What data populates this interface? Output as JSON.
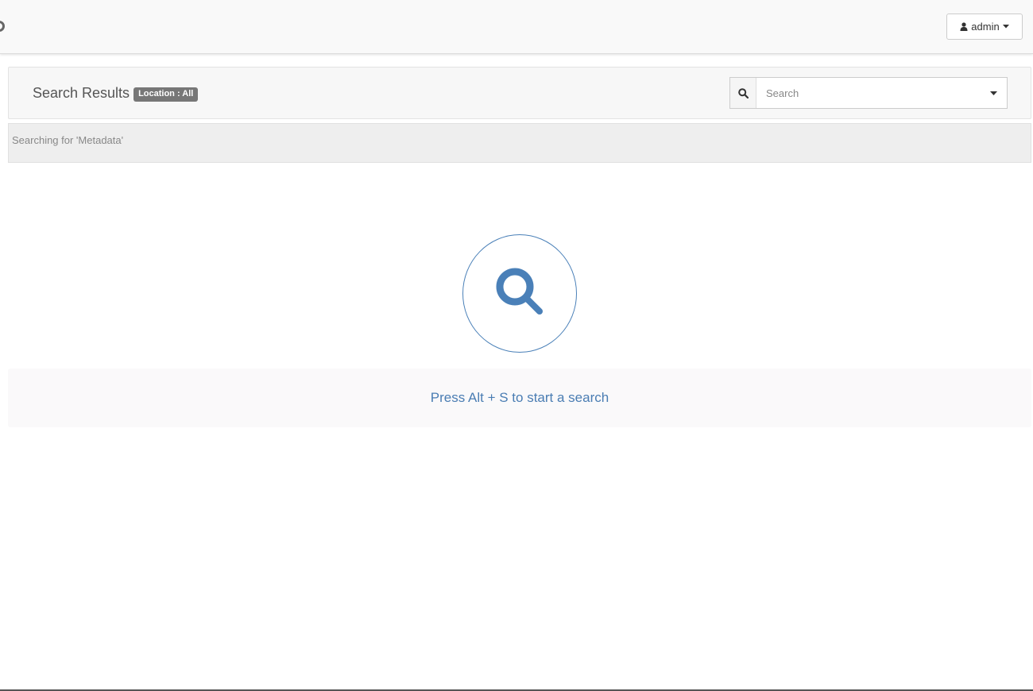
{
  "header": {
    "user_menu": {
      "label": "admin",
      "icon": "user-icon",
      "caret_icon": "caret-down-icon"
    }
  },
  "results": {
    "title": "Search Results",
    "location_badge": "Location : All",
    "search": {
      "placeholder": "Search",
      "value": "",
      "icon": "search-icon",
      "dropdown_icon": "caret-down-icon"
    },
    "status_text": "Searching for 'Metadata'"
  },
  "empty_state": {
    "icon": "magnifier-icon",
    "hint": "Press Alt + S to start a search"
  },
  "colors": {
    "accent": "#4a80b8",
    "badge_bg": "#777777",
    "hint_text": "#4a7db3"
  }
}
